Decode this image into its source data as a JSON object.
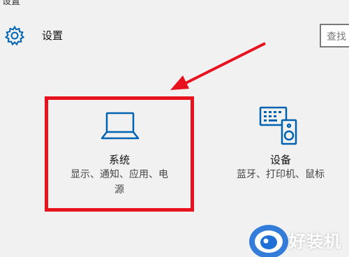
{
  "window": {
    "title": "设置"
  },
  "header": {
    "title": "设置",
    "icon": "gear-icon",
    "search_text": "查找"
  },
  "tiles": [
    {
      "title": "系统",
      "desc_line1": "显示、通知、应用、电",
      "desc_line2": "源",
      "icon": "laptop-icon"
    },
    {
      "title": "设备",
      "desc_line1": "蓝牙、打印机、鼠标",
      "icon": "devices-icon"
    }
  ],
  "annotation": {
    "color": "#e8121e"
  },
  "watermark": {
    "text": "好装机"
  },
  "colors": {
    "accent": "#0063b1",
    "background": "#f1f1f1"
  }
}
